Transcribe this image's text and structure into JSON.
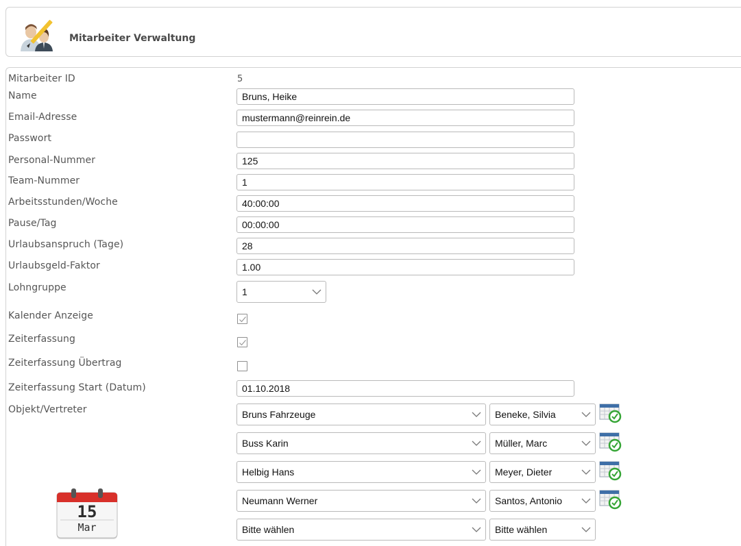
{
  "header": {
    "title": "Mitarbeiter Verwaltung",
    "icon": "user-edit-icon"
  },
  "form": {
    "id": {
      "label": "Mitarbeiter ID",
      "value": "5"
    },
    "name": {
      "label": "Name",
      "value": "Bruns, Heike"
    },
    "email": {
      "label": "Email-Adresse",
      "value": "mustermann@reinrein.de"
    },
    "password": {
      "label": "Passwort",
      "value": ""
    },
    "personal_nr": {
      "label": "Personal-Nummer",
      "value": "125"
    },
    "team_nr": {
      "label": "Team-Nummer",
      "value": "1"
    },
    "work_hours": {
      "label": "Arbeitsstunden/Woche",
      "value": "40:00:00"
    },
    "pause": {
      "label": "Pause/Tag",
      "value": "00:00:00"
    },
    "vacation": {
      "label": "Urlaubsanspruch (Tage)",
      "value": "28"
    },
    "vacation_factor": {
      "label": "Urlaubsgeld-Faktor",
      "value": "1.00"
    },
    "wage_group": {
      "label": "Lohngruppe",
      "value": "1"
    },
    "calendar_display": {
      "label": "Kalender Anzeige",
      "checked": true
    },
    "time_tracking": {
      "label": "Zeiterfassung",
      "checked": true
    },
    "time_tracking_transfer": {
      "label": "Zeiterfassung Übertrag",
      "checked": false
    },
    "time_tracking_start": {
      "label": "Zeiterfassung Start (Datum)",
      "value": "01.10.2018"
    },
    "objects": {
      "label": "Objekt/Vertreter",
      "rows": [
        {
          "object": "Bruns Fahrzeuge",
          "deputy": "Beneke, Silvia"
        },
        {
          "object": "Buss Karin",
          "deputy": "Müller, Marc"
        },
        {
          "object": "Helbig Hans",
          "deputy": "Meyer, Dieter"
        },
        {
          "object": "Neumann Werner",
          "deputy": "Santos, Antonio"
        },
        {
          "object": "Bitte wählen",
          "deputy": "Bitte wählen"
        }
      ]
    }
  },
  "calendar_widget": {
    "day": "15",
    "month": "Mar"
  },
  "colors": {
    "calendar_red": "#d8302a",
    "clock_green": "#35a535",
    "border": "#b9b9b9"
  }
}
